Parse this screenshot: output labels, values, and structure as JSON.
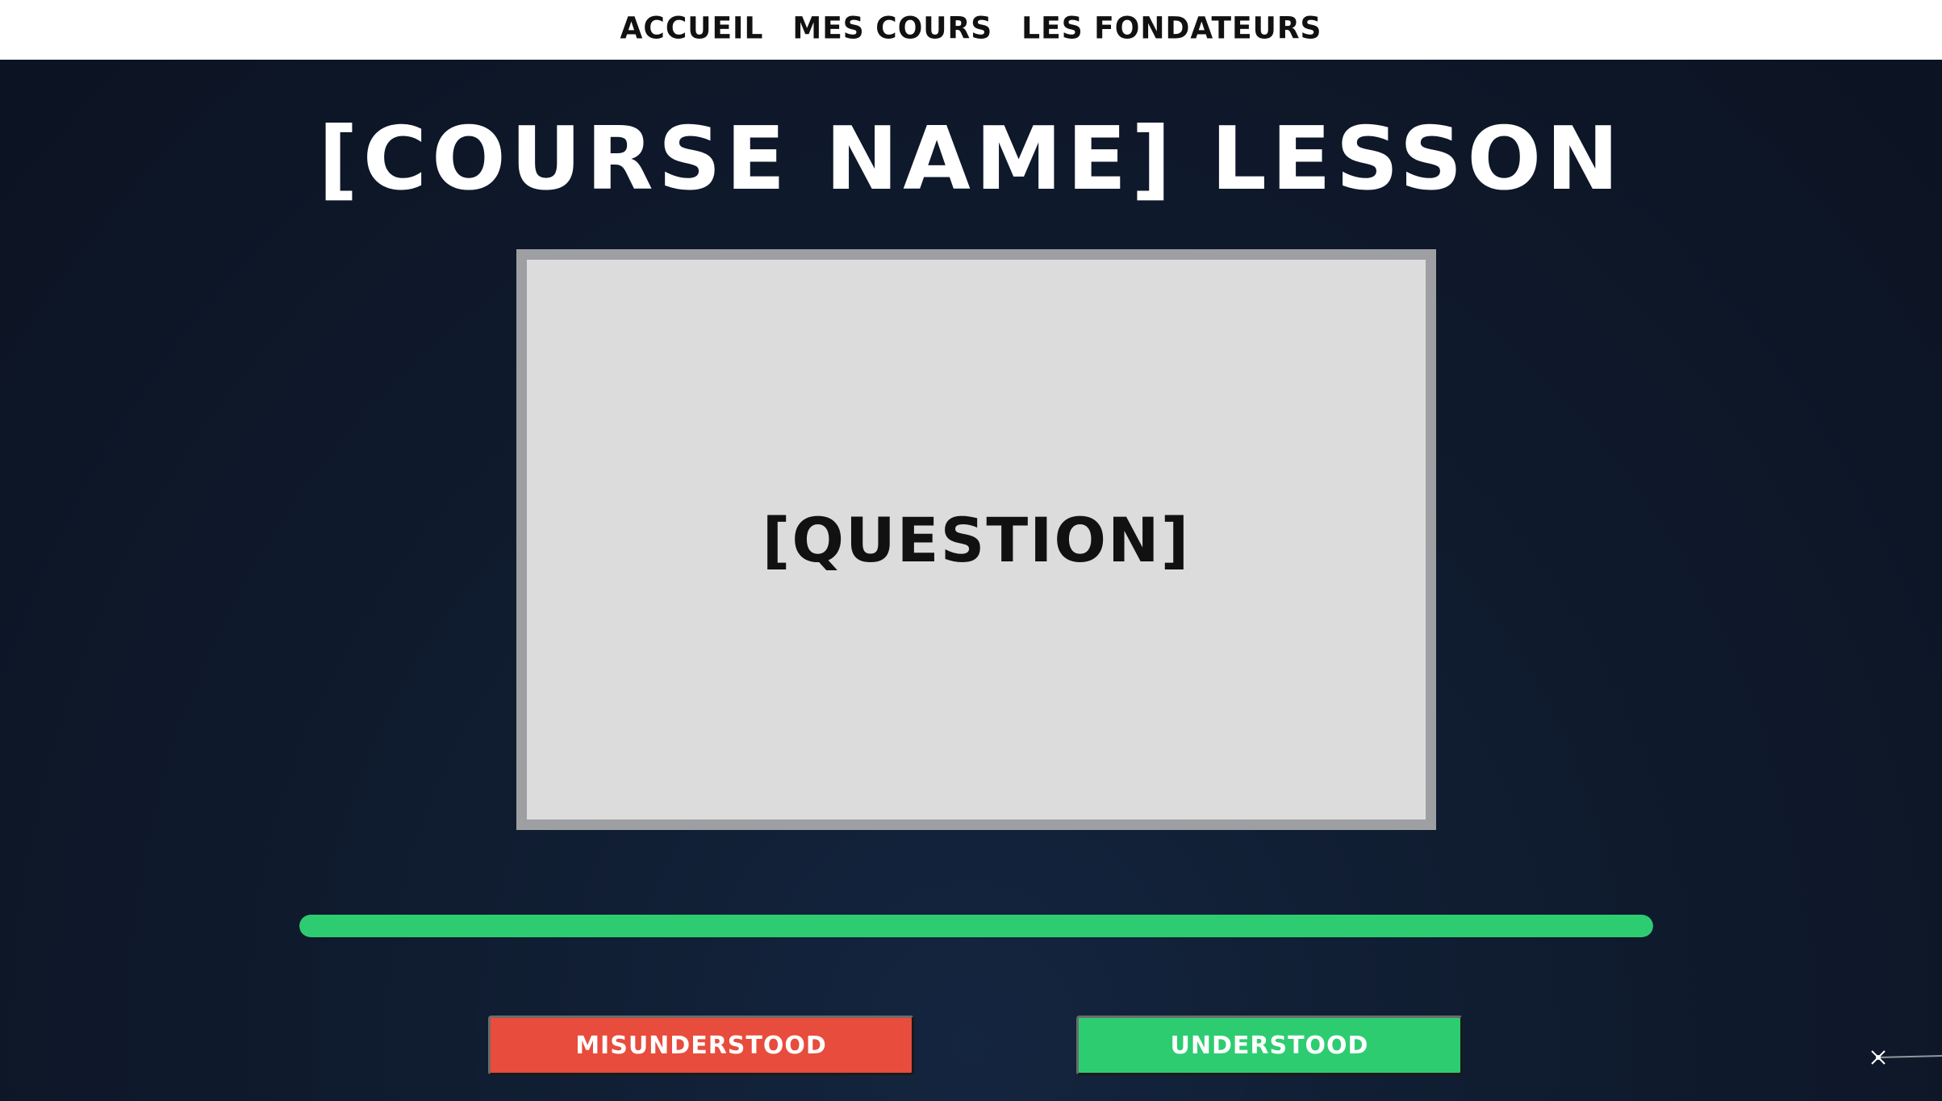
{
  "nav": {
    "items": [
      {
        "label": "Accueil"
      },
      {
        "label": "Mes cours"
      },
      {
        "label": "Les fondateurs"
      }
    ]
  },
  "lesson": {
    "title": "[Course name] lesson",
    "card_text": "[Question]",
    "progress_percent": 100
  },
  "actions": {
    "misunderstood_label": "Misunderstood",
    "understood_label": "Understood"
  },
  "colors": {
    "background": "#0f1b2e",
    "card": "#dcdcdc",
    "card_border": "#9e9fa3",
    "progress": "#2ecc71",
    "misunderstood": "#e74c3c",
    "understood": "#2ecc71"
  },
  "icons": {
    "decoration": "shooting-star-icon"
  }
}
